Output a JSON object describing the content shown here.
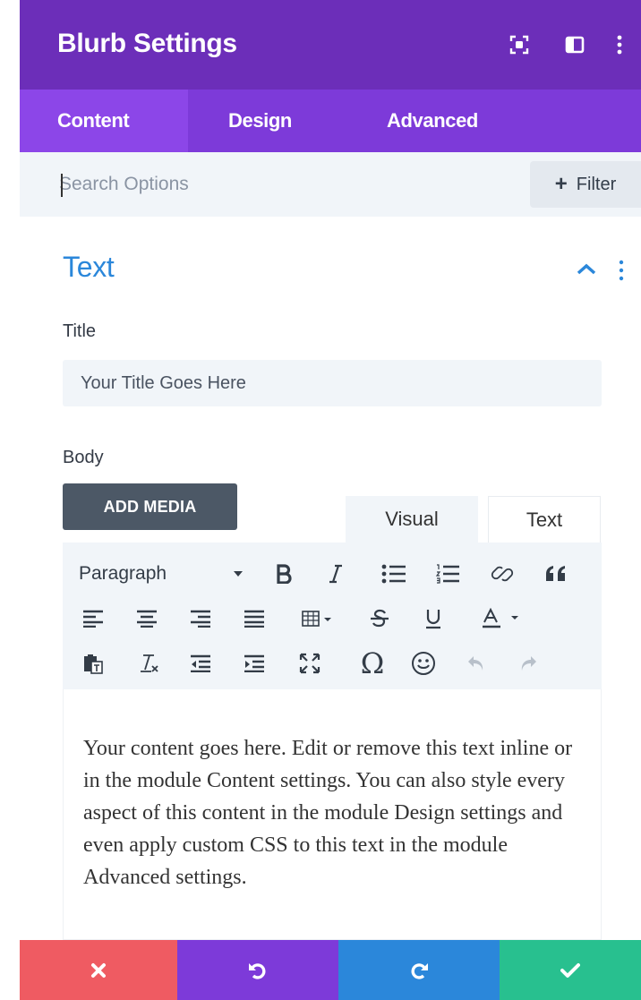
{
  "header": {
    "title": "Blurb Settings",
    "icons": [
      "focus-icon",
      "split-view-icon",
      "more-vertical-icon"
    ],
    "color": "#6c2eb9"
  },
  "tabs": [
    {
      "label": "Content",
      "active": true
    },
    {
      "label": "Design",
      "active": false
    },
    {
      "label": "Advanced",
      "active": false
    }
  ],
  "search": {
    "placeholder": "Search Options",
    "value": "",
    "filter_label": "Filter"
  },
  "section": {
    "title": "Text",
    "expanded": true
  },
  "fields": {
    "title_label": "Title",
    "title_value": "Your Title Goes Here",
    "body_label": "Body"
  },
  "editor": {
    "add_media_label": "ADD MEDIA",
    "tabs": [
      {
        "label": "Visual",
        "active": true
      },
      {
        "label": "Text",
        "active": false
      }
    ],
    "format_select": "Paragraph",
    "toolbar_rows": [
      [
        "format-select",
        "bold-icon",
        "italic-icon",
        "bullet-list-icon",
        "numbered-list-icon",
        "link-icon",
        "blockquote-icon"
      ],
      [
        "align-left-icon",
        "align-center-icon",
        "align-right-icon",
        "align-justify-icon",
        "table-icon",
        "strikethrough-icon",
        "underline-icon",
        "text-color-icon"
      ],
      [
        "paste-text-icon",
        "clear-formatting-icon",
        "outdent-icon",
        "indent-icon",
        "fullscreen-icon",
        "special-character-icon",
        "emoji-icon",
        "undo-icon",
        "redo-icon"
      ]
    ],
    "content": "Your content goes here. Edit or remove this text inline or in the module Content settings. You can also style every aspect of this content in the module Design settings and even apply custom CSS to this text in the module Advanced settings."
  },
  "footer": {
    "buttons": [
      {
        "name": "discard",
        "icon": "close-icon",
        "color": "#ef5b62"
      },
      {
        "name": "undo",
        "icon": "undo-icon",
        "color": "#7d3ad9"
      },
      {
        "name": "redo",
        "icon": "redo-icon",
        "color": "#2b87da"
      },
      {
        "name": "save",
        "icon": "check-icon",
        "color": "#28c08f"
      }
    ]
  }
}
